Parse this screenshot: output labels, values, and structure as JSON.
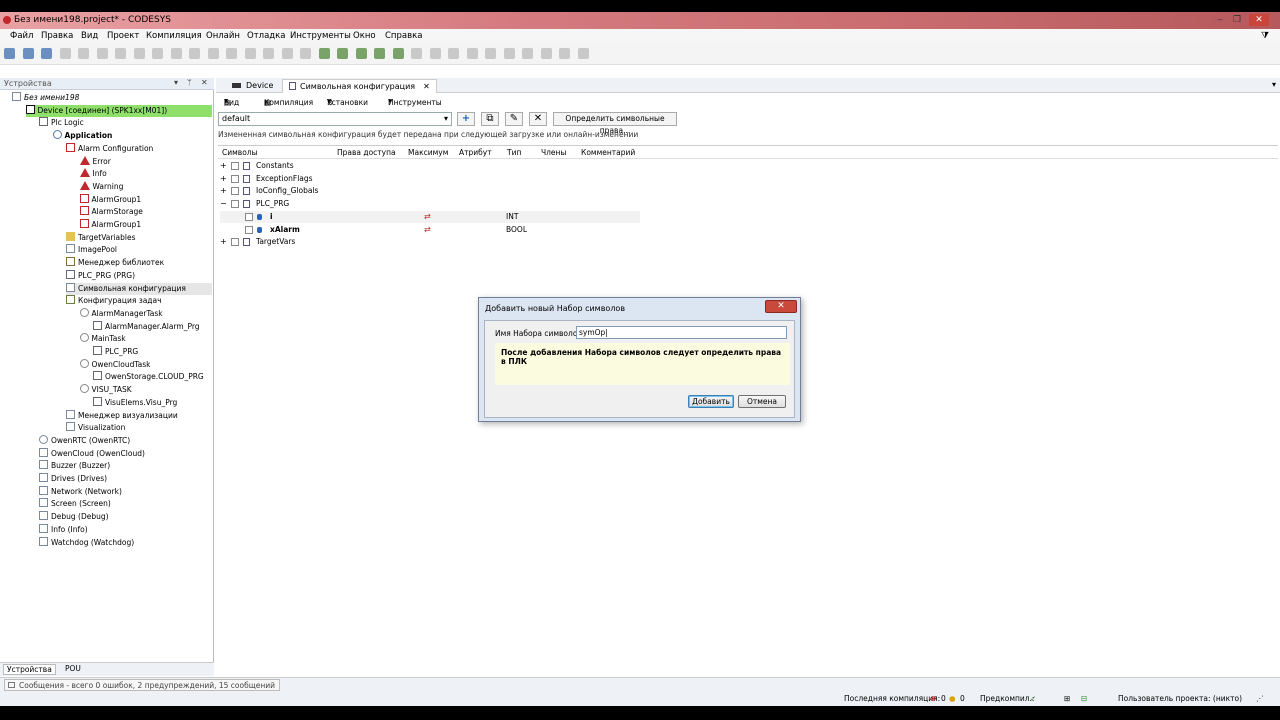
{
  "window": {
    "title": "Без имени198.project* - CODESYS"
  },
  "menu": [
    "Файл",
    "Правка",
    "Вид",
    "Проект",
    "Компиляция",
    "Онлайн",
    "Отладка",
    "Инструменты",
    "Окно",
    "Справка"
  ],
  "devices_panel": {
    "title": "Устройства",
    "tree": [
      {
        "label": "Без имени198",
        "depth": 0,
        "icon": "project-icon"
      },
      {
        "label": "Device [соединен] (SPK1xx[M01])",
        "depth": 1,
        "icon": "device-icon",
        "highlight": true
      },
      {
        "label": "Plc Logic",
        "depth": 2,
        "icon": "plc-logic-icon"
      },
      {
        "label": "Application",
        "depth": 3,
        "icon": "application-icon",
        "bold": true
      },
      {
        "label": "Alarm Configuration",
        "depth": 4,
        "icon": "alarm-config-icon"
      },
      {
        "label": "Error",
        "depth": 5,
        "icon": "warning-icon"
      },
      {
        "label": "Info",
        "depth": 5,
        "icon": "warning-icon"
      },
      {
        "label": "Warning",
        "depth": 5,
        "icon": "warning-icon"
      },
      {
        "label": "AlarmGroup1",
        "depth": 5,
        "icon": "alarm-group-icon"
      },
      {
        "label": "AlarmStorage",
        "depth": 5,
        "icon": "alarm-storage-icon"
      },
      {
        "label": "AlarmGroup1",
        "depth": 5,
        "icon": "alarm-group-icon"
      },
      {
        "label": "TargetVariables",
        "depth": 4,
        "icon": "folder-icon"
      },
      {
        "label": "ImagePool",
        "depth": 4,
        "icon": "imagepool-icon"
      },
      {
        "label": "Менеджер библиотек",
        "depth": 4,
        "icon": "library-icon"
      },
      {
        "label": "PLC_PRG (PRG)",
        "depth": 4,
        "icon": "program-icon"
      },
      {
        "label": "Символьная конфигурация",
        "depth": 4,
        "icon": "symbol-config-icon",
        "selected": true
      },
      {
        "label": "Конфигурация задач",
        "depth": 4,
        "icon": "task-config-icon"
      },
      {
        "label": "AlarmManagerTask",
        "depth": 5,
        "icon": "task-icon"
      },
      {
        "label": "AlarmManager.Alarm_Prg",
        "depth": 6,
        "icon": "program-icon"
      },
      {
        "label": "MainTask",
        "depth": 5,
        "icon": "task-icon"
      },
      {
        "label": "PLC_PRG",
        "depth": 6,
        "icon": "program-icon"
      },
      {
        "label": "OwenCloudTask",
        "depth": 5,
        "icon": "task-icon"
      },
      {
        "label": "OwenStorage.CLOUD_PRG",
        "depth": 6,
        "icon": "program-icon"
      },
      {
        "label": "VISU_TASK",
        "depth": 5,
        "icon": "task-icon"
      },
      {
        "label": "VisuElems.Visu_Prg",
        "depth": 6,
        "icon": "program-icon"
      },
      {
        "label": "Менеджер визуализации",
        "depth": 4,
        "icon": "visu-manager-icon"
      },
      {
        "label": "Visualization",
        "depth": 4,
        "icon": "visualization-icon"
      },
      {
        "label": "OwenRTC (OwenRTC)",
        "depth": 2,
        "icon": "clock-icon"
      },
      {
        "label": "OwenCloud (OwenCloud)",
        "depth": 2,
        "icon": "cloud-icon"
      },
      {
        "label": "Buzzer (Buzzer)",
        "depth": 2,
        "icon": "speaker-icon"
      },
      {
        "label": "Drives (Drives)",
        "depth": 2,
        "icon": "drive-icon"
      },
      {
        "label": "Network (Network)",
        "depth": 2,
        "icon": "network-icon"
      },
      {
        "label": "Screen (Screen)",
        "depth": 2,
        "icon": "screen-icon"
      },
      {
        "label": "Debug (Debug)",
        "depth": 2,
        "icon": "debug-icon"
      },
      {
        "label": "Info (Info)",
        "depth": 2,
        "icon": "info-icon"
      },
      {
        "label": "Watchdog (Watchdog)",
        "depth": 2,
        "icon": "watchdog-icon"
      }
    ],
    "bottom_tabs": [
      "Устройства",
      "POU"
    ]
  },
  "editor": {
    "tabs": [
      "Device",
      "Символьная конфигурация"
    ],
    "toolbar": [
      "Вид",
      "Компиляция",
      "Установки",
      "Инструменты"
    ],
    "symbol_set": "default",
    "define_rights_button": "Определить символьные права...",
    "notice": "Измененная символьная конфигурация будет передана при следующей загрузке или онлайн-изменении",
    "columns": [
      "Символы",
      "Права доступа",
      "Максимум",
      "Атрибут",
      "Тип",
      "Члены",
      "Комментарий"
    ],
    "rows": [
      {
        "label": "Constants",
        "level": 0,
        "type": ""
      },
      {
        "label": "ExceptionFlags",
        "level": 0,
        "type": ""
      },
      {
        "label": "IoConfig_Globals",
        "level": 0,
        "type": ""
      },
      {
        "label": "PLC_PRG",
        "level": 0,
        "type": "",
        "expanded": true
      },
      {
        "label": "i",
        "level": 1,
        "type": "INT"
      },
      {
        "label": "xAlarm",
        "level": 1,
        "type": "BOOL"
      },
      {
        "label": "TargetVars",
        "level": 0,
        "type": ""
      }
    ]
  },
  "dialog": {
    "title": "Добавить новый Набор символов",
    "field_label": "Имя Набора символов",
    "field_value": "symOp|",
    "note": "После добавления Набора символов следует определить права в ПЛК",
    "add_button": "Добавить",
    "cancel_button": "Отмена",
    "close": "✕"
  },
  "status": {
    "messages": "Сообщения - всего 0 ошибок, 2 предупреждений, 15 сообщений",
    "last_compile_label": "Последняя компиляция:",
    "errors": "0",
    "warnings": "0",
    "precompile_label": "Предкомпил.:",
    "project_user": "Пользователь проекта: (никто)"
  }
}
